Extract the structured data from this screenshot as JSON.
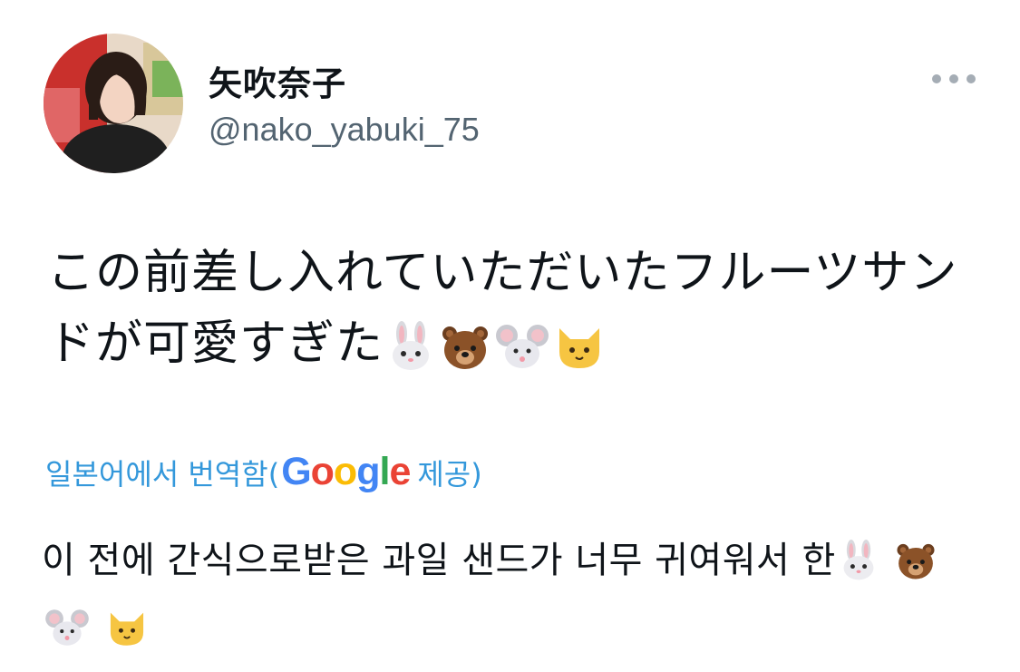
{
  "author": {
    "display_name": "矢吹奈子",
    "handle": "@nako_yabuki_75"
  },
  "more_icon": "ellipsis-icon",
  "tweet": {
    "text": "この前差し入れていただいたフルーツサンドが可愛すぎた",
    "emojis": [
      "rabbit-face",
      "bear-face",
      "mouse-face",
      "cat-face"
    ]
  },
  "translation": {
    "label": "일본어에서 번역함(",
    "provider": "Google",
    "suffix": " 제공)",
    "text": "이 전에 간식으로받은 과일 샌드가 너무 귀여워서 한"
  },
  "colors": {
    "link": "#3498db",
    "secondary_text": "#536471",
    "primary_text": "#0f1419"
  }
}
